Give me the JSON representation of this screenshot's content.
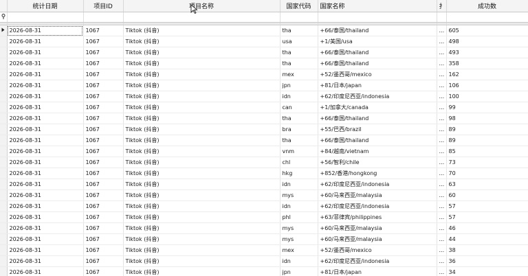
{
  "columns": {
    "date": "统计日期",
    "project_id": "项目ID",
    "project_name": "项目名称",
    "country_code": "国家代码",
    "country_name": "国家名称",
    "ext": "扌",
    "success_count": "成功数"
  },
  "filter_row_icon": "filter-pin-icon",
  "current_row_icon": "current-row-arrow-icon",
  "rows": [
    {
      "date": "2026-08-31",
      "id": "1067",
      "name": "Tiktok (抖音)",
      "code": "tha",
      "country": "+66/泰国/thailand",
      "ext": "...",
      "success": "605"
    },
    {
      "date": "2026-08-31",
      "id": "1067",
      "name": "Tiktok (抖音)",
      "code": "usa",
      "country": "+1/美国/usa",
      "ext": "...",
      "success": "498"
    },
    {
      "date": "2026-08-31",
      "id": "1067",
      "name": "Tiktok (抖音)",
      "code": "tha",
      "country": "+66/泰国/thailand",
      "ext": "...",
      "success": "493"
    },
    {
      "date": "2026-08-31",
      "id": "1067",
      "name": "Tiktok (抖音)",
      "code": "tha",
      "country": "+66/泰国/thailand",
      "ext": "...",
      "success": "358"
    },
    {
      "date": "2026-08-31",
      "id": "1067",
      "name": "Tiktok (抖音)",
      "code": "mex",
      "country": "+52/墨西哥/mexico",
      "ext": "...",
      "success": "162"
    },
    {
      "date": "2026-08-31",
      "id": "1067",
      "name": "Tiktok (抖音)",
      "code": "jpn",
      "country": "+81/日本/japan",
      "ext": "...",
      "success": "106"
    },
    {
      "date": "2026-08-31",
      "id": "1067",
      "name": "Tiktok (抖音)",
      "code": "idn",
      "country": "+62/印度尼西亚/indonesia",
      "ext": "...",
      "success": "100"
    },
    {
      "date": "2026-08-31",
      "id": "1067",
      "name": "Tiktok (抖音)",
      "code": "can",
      "country": "+1/加拿大/canada",
      "ext": "...",
      "success": "99"
    },
    {
      "date": "2026-08-31",
      "id": "1067",
      "name": "Tiktok (抖音)",
      "code": "tha",
      "country": "+66/泰国/thailand",
      "ext": "...",
      "success": "98"
    },
    {
      "date": "2026-08-31",
      "id": "1067",
      "name": "Tiktok (抖音)",
      "code": "bra",
      "country": "+55/巴西/brazil",
      "ext": "...",
      "success": "89"
    },
    {
      "date": "2026-08-31",
      "id": "1067",
      "name": "Tiktok (抖音)",
      "code": "tha",
      "country": "+66/泰国/thailand",
      "ext": "...",
      "success": "89"
    },
    {
      "date": "2026-08-31",
      "id": "1067",
      "name": "Tiktok (抖音)",
      "code": "vnm",
      "country": "+84/越南/vietnam",
      "ext": "...",
      "success": "85"
    },
    {
      "date": "2026-08-31",
      "id": "1067",
      "name": "Tiktok (抖音)",
      "code": "chl",
      "country": "+56/智利/chile",
      "ext": "...",
      "success": "73"
    },
    {
      "date": "2026-08-31",
      "id": "1067",
      "name": "Tiktok (抖音)",
      "code": "hkg",
      "country": "+852/香港/hongkong",
      "ext": "...",
      "success": "70"
    },
    {
      "date": "2026-08-31",
      "id": "1067",
      "name": "Tiktok (抖音)",
      "code": "idn",
      "country": "+62/印度尼西亚/indonesia",
      "ext": "...",
      "success": "63"
    },
    {
      "date": "2026-08-31",
      "id": "1067",
      "name": "Tiktok (抖音)",
      "code": "mys",
      "country": "+60/马来西亚/malaysia",
      "ext": "...",
      "success": "60"
    },
    {
      "date": "2026-08-31",
      "id": "1067",
      "name": "Tiktok (抖音)",
      "code": "idn",
      "country": "+62/印度尼西亚/indonesia",
      "ext": "...",
      "success": "57"
    },
    {
      "date": "2026-08-31",
      "id": "1067",
      "name": "Tiktok (抖音)",
      "code": "phl",
      "country": "+63/菲律宾/philippines",
      "ext": "...",
      "success": "57"
    },
    {
      "date": "2026-08-31",
      "id": "1067",
      "name": "Tiktok (抖音)",
      "code": "mys",
      "country": "+60/马来西亚/malaysia",
      "ext": "...",
      "success": "46"
    },
    {
      "date": "2026-08-31",
      "id": "1067",
      "name": "Tiktok (抖音)",
      "code": "mys",
      "country": "+60/马来西亚/malaysia",
      "ext": "...",
      "success": "44"
    },
    {
      "date": "2026-08-31",
      "id": "1067",
      "name": "Tiktok (抖音)",
      "code": "mex",
      "country": "+52/墨西哥/mexico",
      "ext": "...",
      "success": "38"
    },
    {
      "date": "2026-08-31",
      "id": "1067",
      "name": "Tiktok (抖音)",
      "code": "idn",
      "country": "+62/印度尼西亚/indonesia",
      "ext": "...",
      "success": "36"
    },
    {
      "date": "2026-08-31",
      "id": "1067",
      "name": "Tiktok (抖音)",
      "code": "jpn",
      "country": "+81/日本/japan",
      "ext": "...",
      "success": "34"
    }
  ]
}
